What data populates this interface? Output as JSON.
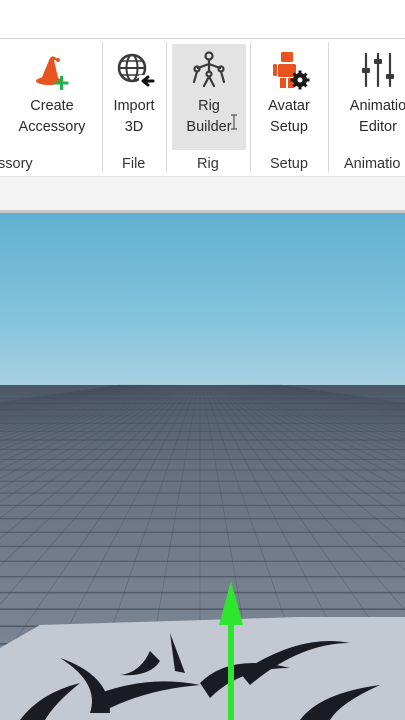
{
  "ribbon": {
    "tools": [
      {
        "id": "create-accessory",
        "label": "Create\nAccessory",
        "icon": "wizard-hat-add-icon"
      },
      {
        "id": "import-3d",
        "label": "Import\n3D",
        "icon": "globe-import-icon"
      },
      {
        "id": "rig-builder",
        "label": "Rig\nBuilder",
        "icon": "rig-skeleton-icon",
        "active": true
      },
      {
        "id": "avatar-setup",
        "label": "Avatar\nSetup",
        "icon": "avatar-gear-icon"
      },
      {
        "id": "animation-editor",
        "label": "Animatio\nEditor",
        "icon": "sliders-icon"
      }
    ],
    "groups": [
      {
        "id": "accessory",
        "label": "ssory"
      },
      {
        "id": "file",
        "label": "File"
      },
      {
        "id": "rig",
        "label": "Rig"
      },
      {
        "id": "setup",
        "label": "Setup"
      },
      {
        "id": "animation",
        "label": "Animatio"
      }
    ]
  },
  "colors": {
    "accent_orange": "#e8531f",
    "accent_green": "#22b14c",
    "icon_dark": "#3a3a3a",
    "sky_top": "#5fb0d1",
    "baseplate": "#bfc3cc",
    "move_arrow": "#2ee62e"
  }
}
